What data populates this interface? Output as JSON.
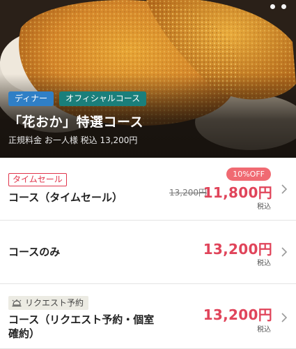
{
  "hero": {
    "tags": [
      "ディナー",
      "オフィシャルコース"
    ],
    "title": "「花おか」特選コース",
    "regular_price": "正規料金 お一人様 税込 13,200円",
    "carousel_dots": 2
  },
  "courses": [
    {
      "badge": "タイムセール",
      "badge_icon": "",
      "name": "コース（タイムセール）",
      "discount_badge": "10%OFF",
      "original_price": "13,200円",
      "price": "11,800円",
      "tax_note": "税込"
    },
    {
      "name": "コースのみ",
      "price": "13,200円",
      "tax_note": "税込"
    },
    {
      "badge": "リクエスト予約",
      "badge_icon": "service-bell-icon",
      "name_line1": "コース（リクエスト予約・個室",
      "name_line2": "確約）",
      "price": "13,200円",
      "tax_note": "税込"
    }
  ],
  "colors": {
    "price_red": "#e0445a",
    "sale_badge": "#e0344b",
    "off_badge": "#f06a72",
    "tag_dinner": "#2f7fc6",
    "tag_official": "#1a7f7b"
  }
}
